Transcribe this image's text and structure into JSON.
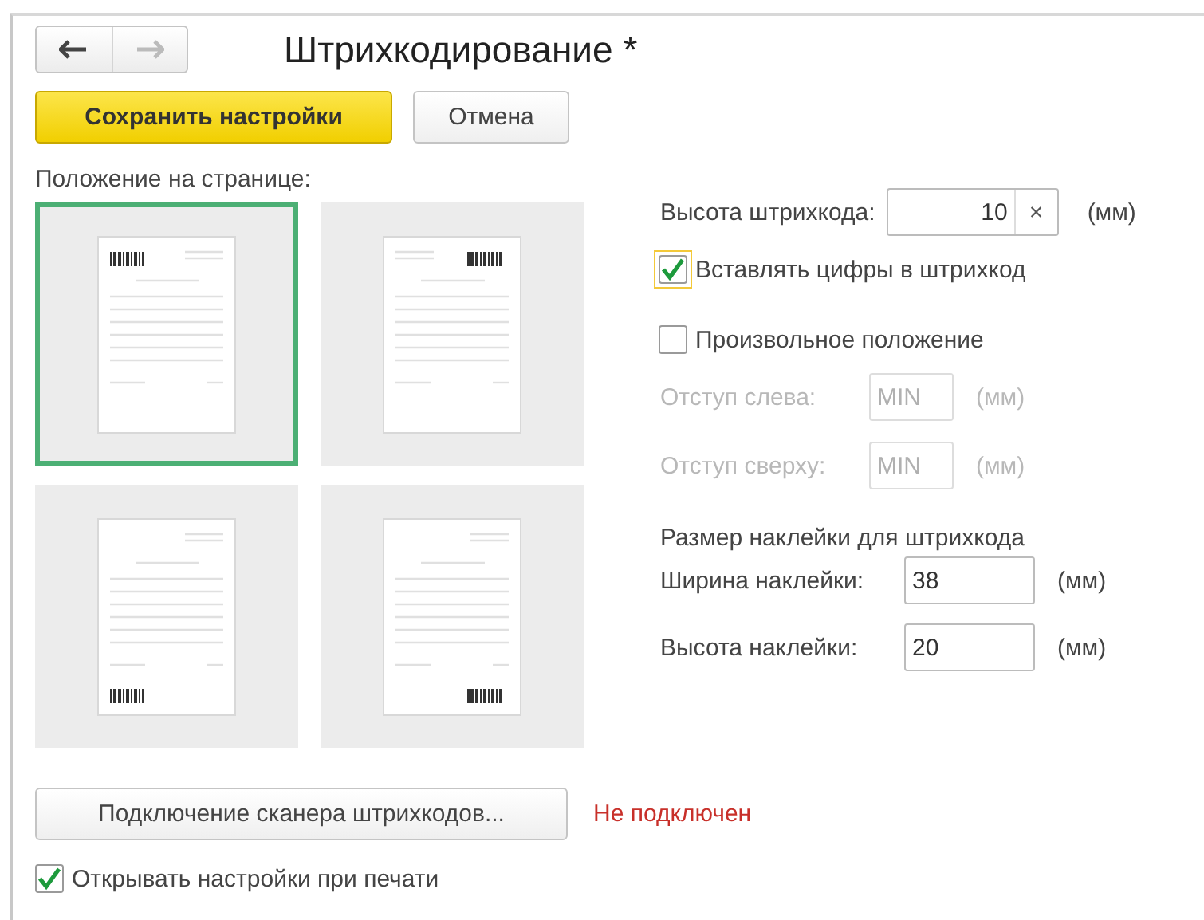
{
  "nav": {
    "back_disabled": false,
    "forward_disabled": true
  },
  "title": "Штрихкодирование *",
  "actions": {
    "save": "Сохранить настройки",
    "cancel": "Отмена"
  },
  "position_label": "Положение на странице:",
  "positions": [
    {
      "kind": "top-left",
      "selected": true
    },
    {
      "kind": "top-right",
      "selected": false
    },
    {
      "kind": "bottom-left",
      "selected": false
    },
    {
      "kind": "bottom-right",
      "selected": false
    }
  ],
  "barcode_height": {
    "label": "Высота штрихкода:",
    "value": "10",
    "clear": "×",
    "unit": "(мм)"
  },
  "insert_digits": {
    "label": "Вставлять цифры в штрихкод",
    "checked": true,
    "focused": true
  },
  "custom_position": {
    "label": "Произвольное положение",
    "checked": false
  },
  "offsets": [
    {
      "label": "Отступ слева:",
      "value": "MIN",
      "unit": "(мм)",
      "disabled": true
    },
    {
      "label": "Отступ сверху:",
      "value": "MIN",
      "unit": "(мм)",
      "disabled": true
    }
  ],
  "sticker": {
    "heading": "Размер наклейки для штрихкода",
    "fields": [
      {
        "label": "Ширина наклейки:",
        "value": "38",
        "unit": "(мм)"
      },
      {
        "label": "Высота наклейки:",
        "value": "20",
        "unit": "(мм)"
      }
    ]
  },
  "scanner": {
    "button": "Подключение сканера штрихкодов...",
    "status": "Не подключен"
  },
  "open_on_print": {
    "label": "Открывать настройки при печати",
    "checked": true
  }
}
